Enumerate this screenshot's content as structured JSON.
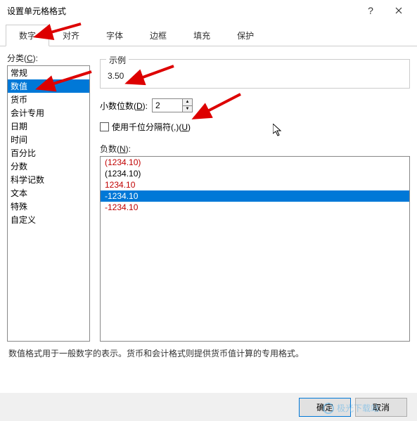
{
  "dialog": {
    "title": "设置单元格格式",
    "help": "?"
  },
  "tabs": [
    {
      "label": "数字",
      "active": true
    },
    {
      "label": "对齐",
      "active": false
    },
    {
      "label": "字体",
      "active": false
    },
    {
      "label": "边框",
      "active": false
    },
    {
      "label": "填充",
      "active": false
    },
    {
      "label": "保护",
      "active": false
    }
  ],
  "category": {
    "label_prefix": "分类(",
    "label_key": "C",
    "label_suffix": "):",
    "items": [
      {
        "label": "常规",
        "selected": false
      },
      {
        "label": "数值",
        "selected": true
      },
      {
        "label": "货币",
        "selected": false
      },
      {
        "label": "会计专用",
        "selected": false
      },
      {
        "label": "日期",
        "selected": false
      },
      {
        "label": "时间",
        "selected": false
      },
      {
        "label": "百分比",
        "selected": false
      },
      {
        "label": "分数",
        "selected": false
      },
      {
        "label": "科学记数",
        "selected": false
      },
      {
        "label": "文本",
        "selected": false
      },
      {
        "label": "特殊",
        "selected": false
      },
      {
        "label": "自定义",
        "selected": false
      }
    ]
  },
  "example": {
    "legend": "示例",
    "value": "3.50"
  },
  "decimal": {
    "label_prefix": "小数位数(",
    "label_key": "D",
    "label_suffix": "):",
    "value": "2"
  },
  "thousand_sep": {
    "label_prefix": "使用千位分隔符(,)(",
    "label_key": "U",
    "label_suffix": ")"
  },
  "negative": {
    "label_prefix": "负数(",
    "label_key": "N",
    "label_suffix": "):",
    "items": [
      {
        "text": "(1234.10)",
        "color": "#c00000",
        "selected": false
      },
      {
        "text": "(1234.10)",
        "color": "#000000",
        "selected": false
      },
      {
        "text": "1234.10",
        "color": "#c00000",
        "selected": false
      },
      {
        "text": "-1234.10",
        "color": "#ffffff",
        "selected": true
      },
      {
        "text": "-1234.10",
        "color": "#c00000",
        "selected": false
      }
    ]
  },
  "description": "数值格式用于一般数字的表示。货币和会计格式则提供货币值计算的专用格式。",
  "buttons": {
    "ok": "确定",
    "cancel": "取消"
  },
  "watermark": "极光下载站"
}
